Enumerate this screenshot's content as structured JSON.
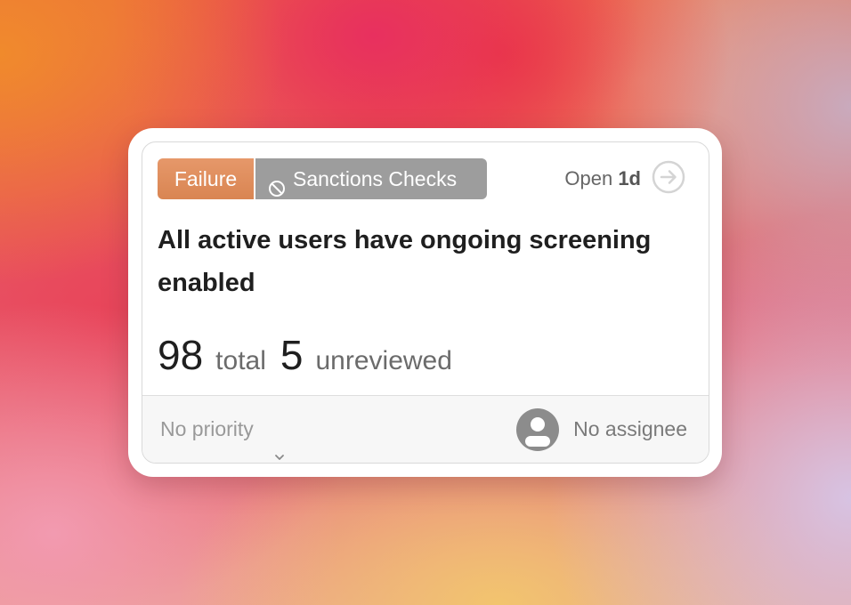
{
  "card": {
    "status_tag": "Failure",
    "category_tag": "Sanctions Checks",
    "category_icon": "ban-icon",
    "open_label": "Open",
    "open_age": "1d",
    "navigate_icon": "arrow-right-circle-icon",
    "title": "All active users have ongoing screening enabled",
    "stats": {
      "total_value": "98",
      "total_label": "total",
      "unreviewed_value": "5",
      "unreviewed_label": "unreviewed"
    },
    "footer": {
      "priority_label": "No priority",
      "priority_icon": "chevron-down-icon",
      "assignee_label": "No assignee",
      "assignee_icon": "user-avatar-icon"
    }
  },
  "colors": {
    "failure_tag": "#DE8C5A",
    "category_tag": "#9D9D9D",
    "footer_bg": "#F7F7F7"
  }
}
